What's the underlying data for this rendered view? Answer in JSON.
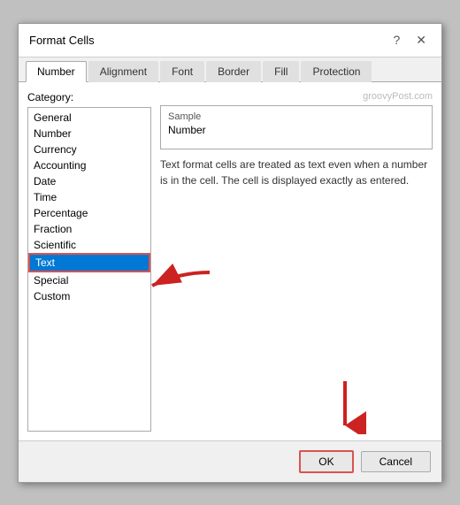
{
  "dialog": {
    "title": "Format Cells",
    "help_icon": "?",
    "close_icon": "✕"
  },
  "tabs": [
    {
      "label": "Number",
      "active": true
    },
    {
      "label": "Alignment",
      "active": false
    },
    {
      "label": "Font",
      "active": false
    },
    {
      "label": "Border",
      "active": false
    },
    {
      "label": "Fill",
      "active": false
    },
    {
      "label": "Protection",
      "active": false
    }
  ],
  "category": {
    "label": "Category:",
    "items": [
      {
        "label": "General",
        "selected": false
      },
      {
        "label": "Number",
        "selected": false
      },
      {
        "label": "Currency",
        "selected": false
      },
      {
        "label": "Accounting",
        "selected": false
      },
      {
        "label": "Date",
        "selected": false
      },
      {
        "label": "Time",
        "selected": false
      },
      {
        "label": "Percentage",
        "selected": false
      },
      {
        "label": "Fraction",
        "selected": false
      },
      {
        "label": "Scientific",
        "selected": false
      },
      {
        "label": "Text",
        "selected": true
      },
      {
        "label": "Special",
        "selected": false
      },
      {
        "label": "Custom",
        "selected": false
      }
    ]
  },
  "sample": {
    "label": "Sample",
    "value": "Number"
  },
  "description": "Text format cells are treated as text even when a number is in the cell. The cell is displayed exactly as entered.",
  "watermark": "groovyPost.com",
  "buttons": {
    "ok": "OK",
    "cancel": "Cancel"
  }
}
